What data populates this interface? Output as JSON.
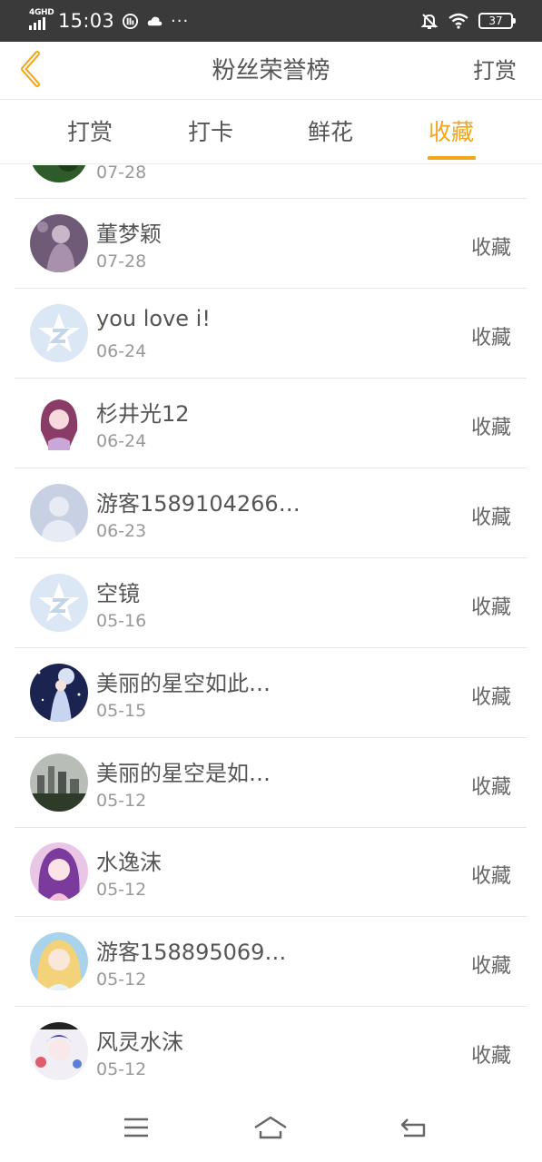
{
  "status_bar": {
    "network": "4GHD",
    "time": "15:03",
    "more": "···",
    "battery": "37"
  },
  "nav": {
    "title": "粉丝荣誉榜",
    "action": "打赏"
  },
  "tabs": [
    {
      "label": "打赏",
      "active": false
    },
    {
      "label": "打卡",
      "active": false
    },
    {
      "label": "鲜花",
      "active": false
    },
    {
      "label": "收藏",
      "active": true
    }
  ],
  "accent_color": "#f2a61b",
  "list": {
    "partial_row": {
      "date": "07-28",
      "avatar": "green-leaf-avatar"
    },
    "rows": [
      {
        "name": "董梦颖",
        "date": "07-28",
        "action": "收藏",
        "avatar": "purple-portrait-avatar"
      },
      {
        "name": "you love i!",
        "date": "06-24",
        "action": "收藏",
        "avatar": "default-star-avatar"
      },
      {
        "name": "杉井光12",
        "date": "06-24",
        "action": "收藏",
        "avatar": "anime-girl-avatar"
      },
      {
        "name": "游客1589104266…",
        "date": "06-23",
        "action": "收藏",
        "avatar": "default-person-avatar"
      },
      {
        "name": "空镜",
        "date": "05-16",
        "action": "收藏",
        "avatar": "default-star-avatar"
      },
      {
        "name": "美丽的星空如此…",
        "date": "05-15",
        "action": "收藏",
        "avatar": "night-sky-girl-avatar"
      },
      {
        "name": "美丽的星空是如…",
        "date": "05-12",
        "action": "收藏",
        "avatar": "city-photo-avatar"
      },
      {
        "name": "水逸沫",
        "date": "05-12",
        "action": "收藏",
        "avatar": "purple-hair-girl-avatar"
      },
      {
        "name": "游客158895069…",
        "date": "05-12",
        "action": "收藏",
        "avatar": "blonde-girl-avatar"
      },
      {
        "name": "风灵水沫",
        "date": "05-12",
        "action": "收藏",
        "avatar": "anime-art-avatar"
      }
    ]
  },
  "bottom_nav": [
    "menu-icon",
    "home-icon",
    "back-icon"
  ]
}
